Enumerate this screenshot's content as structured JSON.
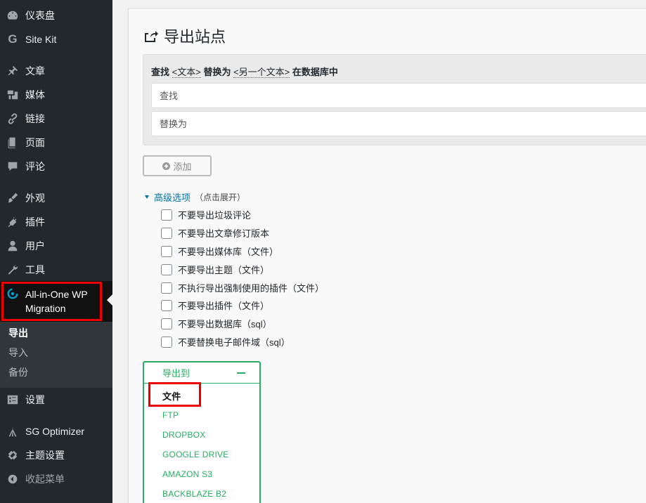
{
  "sidebar": {
    "items": [
      {
        "icon": "dashboard-icon",
        "label": "仪表盘"
      },
      {
        "icon": "google-g-icon",
        "label": "Site Kit"
      },
      {
        "icon": "pin-icon",
        "label": "文章"
      },
      {
        "icon": "media-icon",
        "label": "媒体"
      },
      {
        "icon": "link-icon",
        "label": "链接"
      },
      {
        "icon": "page-icon",
        "label": "页面"
      },
      {
        "icon": "comment-icon",
        "label": "评论"
      },
      {
        "icon": "brush-icon",
        "label": "外观"
      },
      {
        "icon": "plugin-icon",
        "label": "插件"
      },
      {
        "icon": "user-icon",
        "label": "用户"
      },
      {
        "icon": "wrench-icon",
        "label": "工具"
      }
    ],
    "current": {
      "icon": "migration-icon",
      "label": "All-in-One WP Migration"
    },
    "submenu": [
      {
        "label": "导出",
        "active": true
      },
      {
        "label": "导入",
        "active": false
      },
      {
        "label": "备份",
        "active": false
      }
    ],
    "items_after": [
      {
        "icon": "settings-icon",
        "label": "设置"
      },
      {
        "icon": "sg-icon",
        "label": "SG Optimizer"
      },
      {
        "icon": "theme-settings-icon",
        "label": "主题设置"
      },
      {
        "icon": "collapse-icon",
        "label": "收起菜单"
      }
    ]
  },
  "main": {
    "title": "导出站点",
    "replace": {
      "head_prefix": "查找",
      "head_token1": "<文本>",
      "head_mid": "替换为",
      "head_token2": "<另一个文本>",
      "head_suffix": "在数据库中",
      "find_placeholder": "查找",
      "replace_placeholder": "替换为"
    },
    "add_label": "添加",
    "advanced": {
      "label": "高级选项",
      "hint": "（点击展开）",
      "options": [
        "不要导出垃圾评论",
        "不要导出文章修订版本",
        "不要导出媒体库（文件）",
        "不要导出主题（文件）",
        "不执行导出强制使用的插件（文件）",
        "不要导出插件（文件）",
        "不要导出数据库（sql）",
        "不要替换电子邮件域（sql）"
      ]
    },
    "export_to": {
      "label": "导出到",
      "items": [
        "文件",
        "FTP",
        "DROPBOX",
        "GOOGLE DRIVE",
        "AMAZON S3",
        "BACKBLAZE B2"
      ]
    }
  },
  "colors": {
    "sidebar_bg": "#23282d",
    "accent_green": "#27ae60",
    "link_blue": "#0073aa",
    "highlight_red": "#e00000"
  }
}
